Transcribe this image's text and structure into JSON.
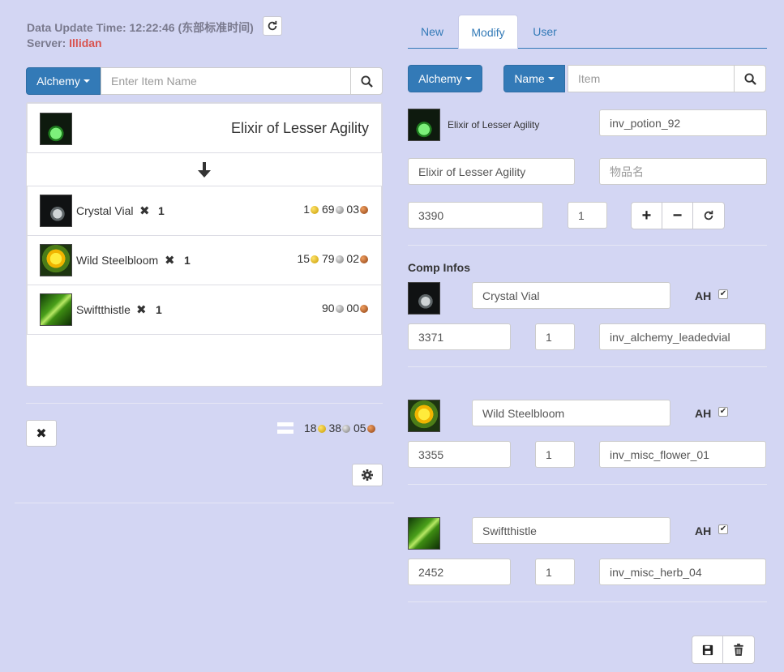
{
  "header": {
    "update_label": "Data Update Time: 12:22:46 (东部标准时间)",
    "server_label": "Server:",
    "server_name": "Illidan"
  },
  "left": {
    "category_button": "Alchemy",
    "search_placeholder": "Enter Item Name",
    "result_item": {
      "name": "Elixir of Lesser Agility",
      "icon": "potion-green-icon"
    },
    "reagents": [
      {
        "name": "Crystal Vial",
        "qty": "1",
        "gold": "1",
        "silver": "69",
        "copper": "03",
        "icon": "vial-icon"
      },
      {
        "name": "Wild Steelbloom",
        "qty": "1",
        "gold": "15",
        "silver": "79",
        "copper": "02",
        "icon": "flower-icon"
      },
      {
        "name": "Swiftthistle",
        "qty": "1",
        "gold": "",
        "silver": "90",
        "copper": "00",
        "icon": "herb-icon"
      }
    ],
    "total": {
      "gold": "18",
      "silver": "38",
      "copper": "05"
    }
  },
  "right": {
    "tabs": [
      "New",
      "Modify",
      "User"
    ],
    "active_tab": "Modify",
    "category_button": "Alchemy",
    "field_button": "Name",
    "search_placeholder": "Item",
    "item": {
      "name": "Elixir of Lesser Agility",
      "icon_name": "inv_potion_92",
      "name_input": "Elixir of Lesser Agility",
      "cn_name_placeholder": "物品名",
      "id": "3390",
      "qty": "1"
    },
    "comp_title": "Comp Infos",
    "ah_label": "AH",
    "components": [
      {
        "name": "Crystal Vial",
        "id": "3371",
        "qty": "1",
        "icon_name": "inv_alchemy_leadedvial",
        "ah": true
      },
      {
        "name": "Wild Steelbloom",
        "id": "3355",
        "qty": "1",
        "icon_name": "inv_misc_flower_01",
        "ah": true
      },
      {
        "name": "Swiftthistle",
        "id": "2452",
        "qty": "1",
        "icon_name": "inv_misc_herb_04",
        "ah": true
      }
    ]
  },
  "colors": {
    "background": "#d3d6f3",
    "primary": "#337ab7",
    "server": "#d9534f"
  }
}
